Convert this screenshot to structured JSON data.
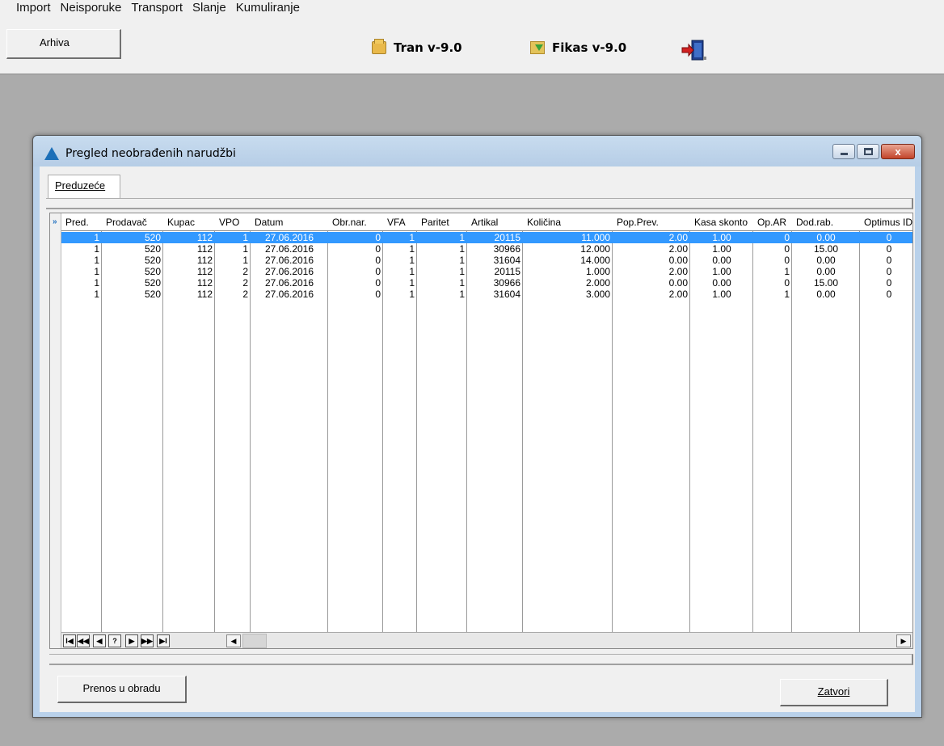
{
  "menu": [
    "Import",
    "Neisporuke",
    "Transport",
    "Slanje",
    "Kumuliranje"
  ],
  "toolbar": {
    "archive_label": "Arhiva",
    "tran_label": "Tran v-9.0",
    "fikas_label": "Fikas v-9.0"
  },
  "dialog": {
    "title": "Pregled neobrađenih narudžbi",
    "tab_label": "Preduzeće",
    "transfer_button": "Prenos u obradu",
    "close_button": "Zatvori",
    "close_glyph": "x"
  },
  "grid": {
    "columns": [
      "Pred.",
      "Prodavač",
      "Kupac",
      "VPO",
      "Datum",
      "Obr.nar.",
      "VFA",
      "Paritet",
      "Artikal",
      "Količina",
      "Pop.Prev.",
      "Kasa skonto",
      "Op.AR",
      "Dod.rab.",
      "Optimus ID"
    ],
    "rows": [
      [
        "1",
        "520",
        "112",
        "1",
        "27.06.2016",
        "0",
        "1",
        "1",
        "20115",
        "11.000",
        "2.00",
        "1.00",
        "0",
        "0.00",
        "0"
      ],
      [
        "1",
        "520",
        "112",
        "1",
        "27.06.2016",
        "0",
        "1",
        "1",
        "30966",
        "12.000",
        "2.00",
        "1.00",
        "0",
        "15.00",
        "0"
      ],
      [
        "1",
        "520",
        "112",
        "1",
        "27.06.2016",
        "0",
        "1",
        "1",
        "31604",
        "14.000",
        "0.00",
        "0.00",
        "0",
        "0.00",
        "0"
      ],
      [
        "1",
        "520",
        "112",
        "2",
        "27.06.2016",
        "0",
        "1",
        "1",
        "20115",
        "1.000",
        "2.00",
        "1.00",
        "1",
        "0.00",
        "0"
      ],
      [
        "1",
        "520",
        "112",
        "2",
        "27.06.2016",
        "0",
        "1",
        "1",
        "30966",
        "2.000",
        "0.00",
        "0.00",
        "0",
        "15.00",
        "0"
      ],
      [
        "1",
        "520",
        "112",
        "2",
        "27.06.2016",
        "0",
        "1",
        "1",
        "31604",
        "3.000",
        "2.00",
        "1.00",
        "1",
        "0.00",
        "0"
      ]
    ],
    "selected_row": 0,
    "nav_buttons": [
      "I◀",
      "◀◀",
      "◀",
      "?",
      "▶",
      "▶▶",
      "▶I"
    ],
    "row_indicator": "»",
    "scroll_left": "◀",
    "scroll_right": "▶"
  }
}
